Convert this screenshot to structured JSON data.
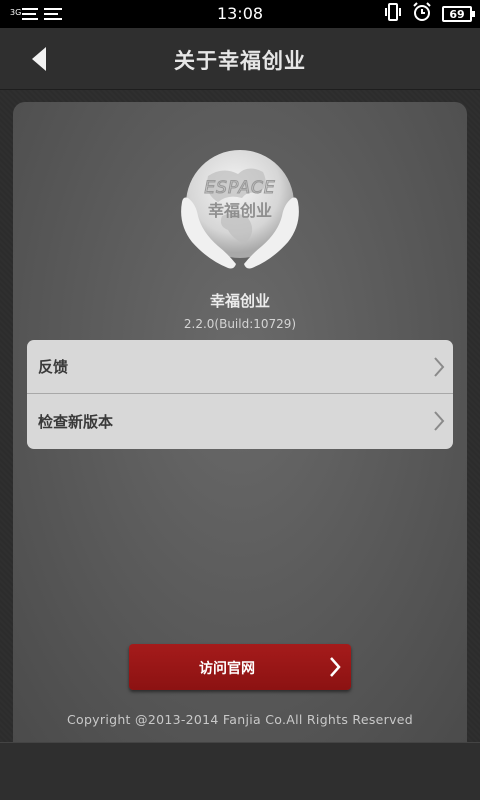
{
  "status_bar": {
    "network": "3G",
    "time": "13:08",
    "battery": "69",
    "icons": [
      "signal-icon",
      "vibrate-icon",
      "alarm-icon",
      "battery-icon"
    ]
  },
  "header": {
    "title": "关于幸福创业",
    "back_icon": "back-arrow-icon"
  },
  "about": {
    "logo_icon": "globe-hands-logo",
    "logo_text_top": "ESPACE",
    "logo_text_bottom": "幸福创业",
    "app_name": "幸福创业",
    "version": "2.2.0(Build:10729)"
  },
  "menu": {
    "items": [
      {
        "label": "反馈"
      },
      {
        "label": "检查新版本"
      }
    ]
  },
  "visit_button": {
    "label": "访问官网"
  },
  "footer": {
    "copyright": "Copyright @2013-2014 Fanjia Co.All Rights Reserved"
  },
  "colors": {
    "accent_button": "#9a1616",
    "menu_bg": "#d8d8d8",
    "card_bg": "#5e5e5e"
  }
}
